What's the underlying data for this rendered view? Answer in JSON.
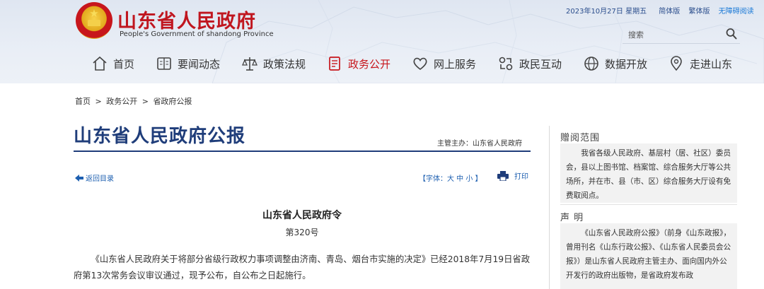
{
  "header": {
    "site_title": "山东省人民政府",
    "site_subtitle": "People's Government of shandong Province",
    "date": "2023年10月27日 星期五",
    "links": [
      "简体版",
      "繁体版"
    ],
    "accessibility": "无障碍阅读",
    "search_placeholder": "搜索"
  },
  "nav": [
    {
      "label": "首页",
      "icon": "home-icon"
    },
    {
      "label": "要闻动态",
      "icon": "newspaper-icon"
    },
    {
      "label": "政策法规",
      "icon": "scales-icon"
    },
    {
      "label": "政务公开",
      "icon": "document-icon",
      "active": true
    },
    {
      "label": "网上服务",
      "icon": "heart-icon"
    },
    {
      "label": "政民互动",
      "icon": "interaction-icon"
    },
    {
      "label": "数据开放",
      "icon": "data-globe-icon"
    },
    {
      "label": "走进山东",
      "icon": "location-icon"
    }
  ],
  "breadcrumb": [
    "首页",
    ">",
    "政务公开",
    ">",
    "省政府公报"
  ],
  "gazette": {
    "title": "山东省人民政府公报",
    "sponsor": "主管主办：山东省人民政府"
  },
  "tools": {
    "back_label": "返回目录",
    "font_size_label": "【字体：大 中 小 】",
    "print_label": "打印"
  },
  "document": {
    "title": "山东省人民政府令",
    "number": "第320号",
    "body": "《山东省人民政府关于将部分省级行政权力事项调整由济南、青岛、烟台市实施的决定》已经2018年7月19日省政府第13次常务会议审议通过，现予公布，自公布之日起施行。"
  },
  "sidebar": {
    "range_title": "赠阅范围",
    "range_text": "我省各级人民政府、基层村（居、社区）委员会，县以上图书馆、档案馆、综合服务大厅等公共场所，并在市、县（市、区）综合服务大厅设有免费取阅点。",
    "statement_title": "声 明",
    "statement_text": "《山东省人民政府公报》（前身《山东政报》，曾用刊名《山东行政公报》、《山东省人民委员会公报》）是山东省人民政府主管主办、面向国内外公开发行的政府出版物，是省政府发布政"
  },
  "colors": {
    "brand_red": "#c0161f",
    "title_blue": "#1f3d7a",
    "link_blue": "#1d5fb0"
  }
}
